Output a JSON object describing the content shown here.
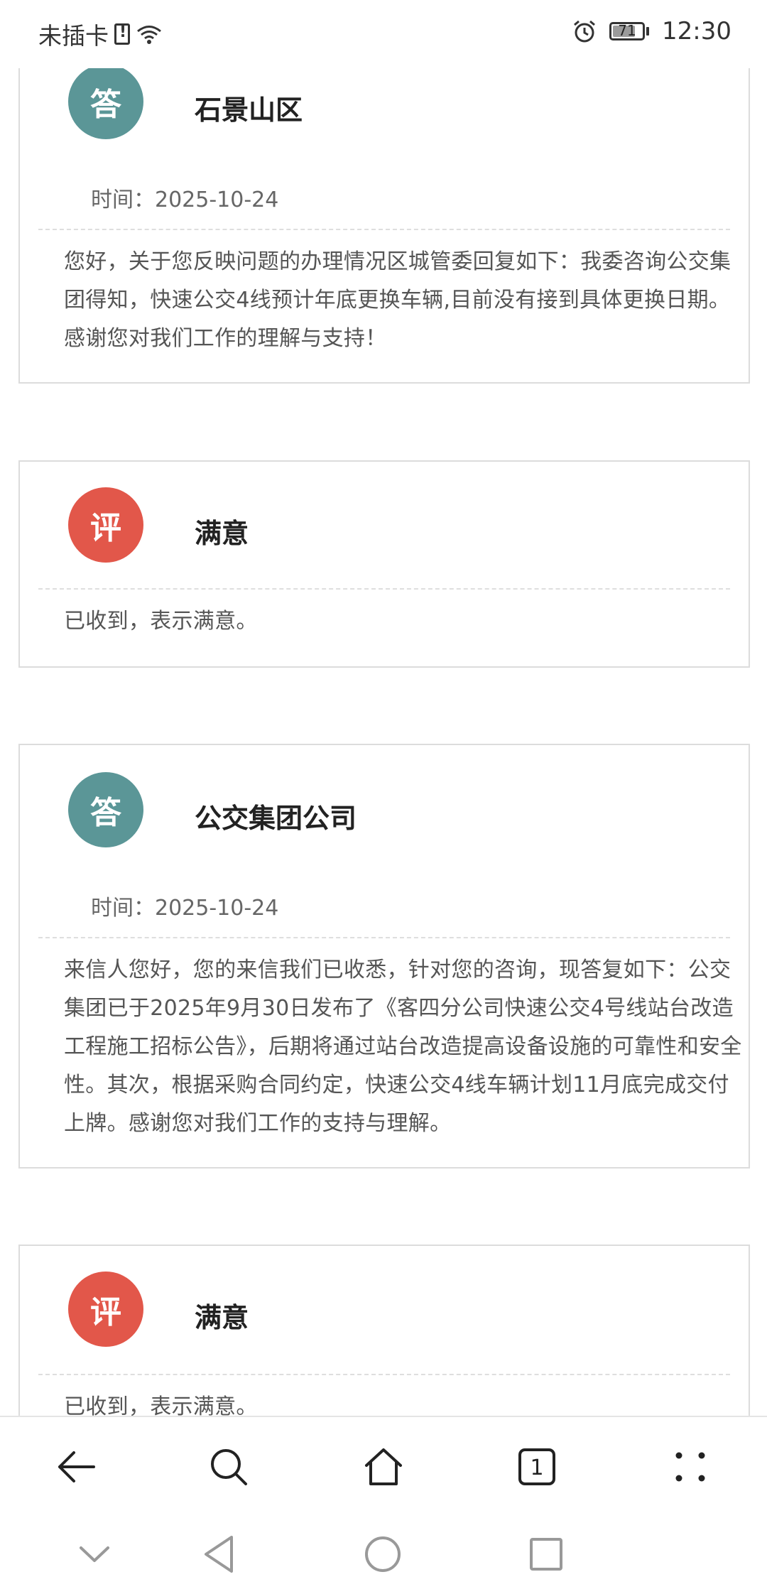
{
  "status_bar": {
    "carrier": "未插卡",
    "battery_level": "71",
    "battery_fraction": 0.71,
    "time": "12:30"
  },
  "cards": [
    {
      "badge": "答",
      "title": "石景山区",
      "time_label": "时间：2025-10-24",
      "body": "您好，关于您反映问题的办理情况区城管委回复如下：我委咨询公交集团得知，快速公交4线预计年底更换车辆,目前没有接到具体更换日期。感谢您对我们工作的理解与支持！"
    },
    {
      "badge": "评",
      "title": "满意",
      "body": "已收到，表示满意。"
    },
    {
      "badge": "答",
      "title": "公交集团公司",
      "time_label": "时间：2025-10-24",
      "body": "来信人您好，您的来信我们已收悉，针对您的咨询，现答复如下：公交集团已于2025年9月30日发布了《客四分公司快速公交4号线站台改造工程施工招标公告》，后期将通过站台改造提高设备设施的可靠性和安全性。其次，根据采购合同约定，快速公交4线车辆计划11月底完成交付上牌。感谢您对我们工作的支持与理解。"
    },
    {
      "badge": "评",
      "title": "满意",
      "body": "已收到，表示满意。"
    }
  ],
  "toolbar": {
    "tab_count": "1",
    "icons": [
      "back-arrow-icon",
      "search-icon",
      "home-icon",
      "tabs-icon",
      "more-icon"
    ]
  },
  "system_nav": {
    "icons": [
      "chevron-down-icon",
      "back-triangle-icon",
      "home-circle-icon",
      "recents-square-icon"
    ]
  },
  "colors": {
    "answer_badge": "#5b9697",
    "review_badge": "#e2574a",
    "border": "#dcdcdc"
  }
}
